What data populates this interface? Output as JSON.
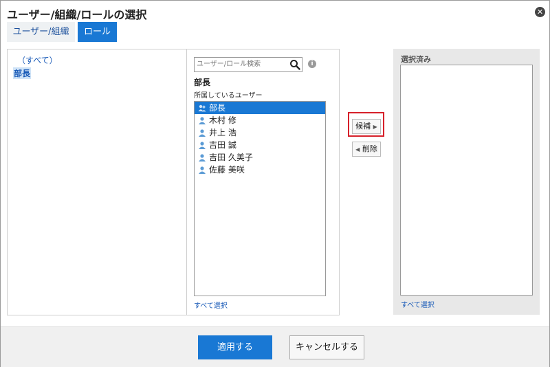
{
  "dialog": {
    "title": "ユーザー/組織/ロールの選択"
  },
  "tabs": [
    {
      "label": "ユーザー/組織"
    },
    {
      "label": "ロール"
    }
  ],
  "tree": {
    "all_label": "（すべて）",
    "role_label": "部長"
  },
  "search": {
    "placeholder": "ユーザー/ロール検索"
  },
  "role_panel": {
    "role_name": "部長",
    "members_label": "所属しているユーザー",
    "members": [
      {
        "label": "部長",
        "icon": "role-icon",
        "selected": true
      },
      {
        "label": "木村 修",
        "icon": "user-icon"
      },
      {
        "label": "井上 浩",
        "icon": "user-icon"
      },
      {
        "label": "吉田 誠",
        "icon": "user-icon"
      },
      {
        "label": "吉田 久美子",
        "icon": "user-icon"
      },
      {
        "label": "佐藤 美咲",
        "icon": "user-icon"
      }
    ],
    "select_all": "すべて選択"
  },
  "actions": {
    "add_label": "候補",
    "remove_label": "削除"
  },
  "selected_panel": {
    "title": "選択済み",
    "select_all": "すべて選択"
  },
  "footer": {
    "apply_label": "適用する",
    "cancel_label": "キャンセルする"
  },
  "colors": {
    "accent": "#1978d4",
    "link": "#1a5bb8",
    "highlight": "#d6202a"
  }
}
